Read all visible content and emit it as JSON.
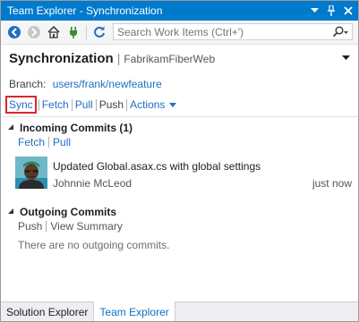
{
  "window": {
    "title": "Team Explorer - Synchronization"
  },
  "toolbar": {
    "search_placeholder": "Search Work Items (Ctrl+')"
  },
  "header": {
    "title": "Synchronization",
    "project": "FabrikamFiberWeb"
  },
  "branch": {
    "label": "Branch:",
    "name": "users/frank/newfeature"
  },
  "actions": {
    "sync": "Sync",
    "fetch": "Fetch",
    "pull": "Pull",
    "push": "Push",
    "actions": "Actions"
  },
  "incoming": {
    "title": "Incoming Commits (1)",
    "fetch": "Fetch",
    "pull": "Pull",
    "commits": [
      {
        "message": "Updated Global.asax.cs with global settings",
        "author": "Johnnie McLeod",
        "time": "just now"
      }
    ]
  },
  "outgoing": {
    "title": "Outgoing Commits",
    "push": "Push",
    "view_summary": "View Summary",
    "empty": "There are no outgoing commits."
  },
  "bottom_tabs": [
    {
      "label": "Solution Explorer",
      "active": false
    },
    {
      "label": "Team Explorer",
      "active": true
    }
  ],
  "colors": {
    "titlebar": "#007acc",
    "link": "#1e6fc1",
    "highlight": "#d9262f"
  }
}
